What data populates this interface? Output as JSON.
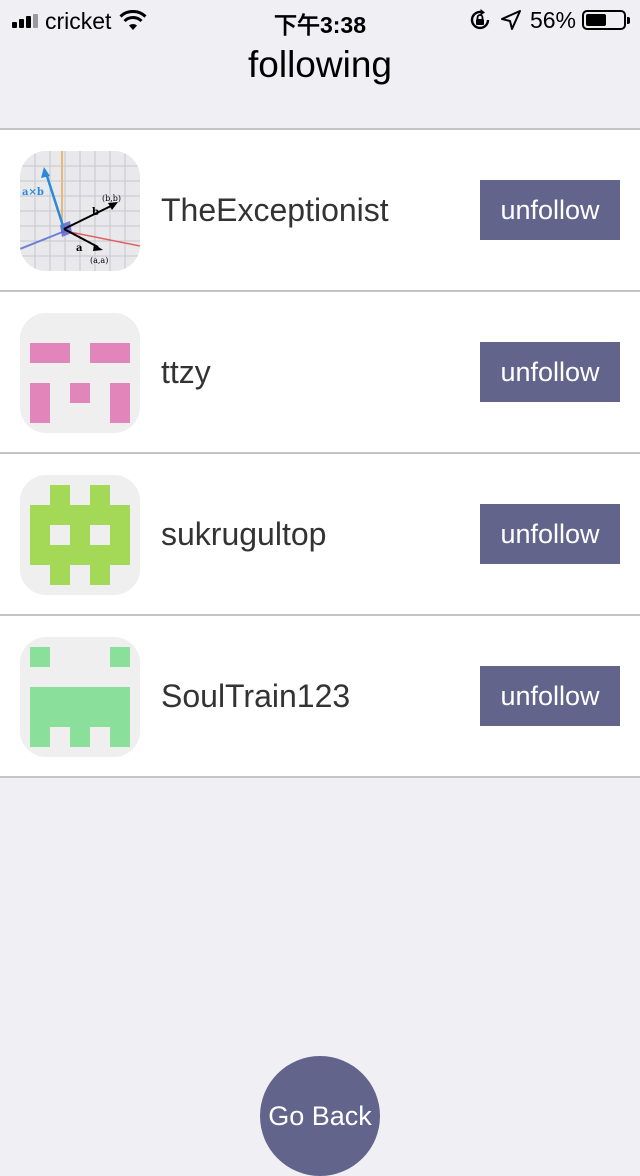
{
  "status_bar": {
    "carrier": "cricket",
    "time": "下午3:38",
    "battery_percent": "56%",
    "battery_level": 0.56,
    "icons": [
      "cellular-signal-icon",
      "wifi-icon",
      "rotation-lock-icon",
      "location-arrow-icon",
      "battery-icon"
    ]
  },
  "header": {
    "title": "following"
  },
  "following": [
    {
      "username": "TheExceptionist",
      "action_label": "unfollow",
      "avatar": "vector-diagram-avatar"
    },
    {
      "username": "ttzy",
      "action_label": "unfollow",
      "avatar": "identicon-pink",
      "avatar_color": "#e285bb"
    },
    {
      "username": "sukrugultop",
      "action_label": "unfollow",
      "avatar": "identicon-lime",
      "avatar_color": "#a4d957"
    },
    {
      "username": "SoulTrain123",
      "action_label": "unfollow",
      "avatar": "identicon-green",
      "avatar_color": "#8ae09b"
    }
  ],
  "go_back_label": "Go Back",
  "colors": {
    "button": "#62648c",
    "background": "#efeff4",
    "separator": "#c4c4c4"
  }
}
